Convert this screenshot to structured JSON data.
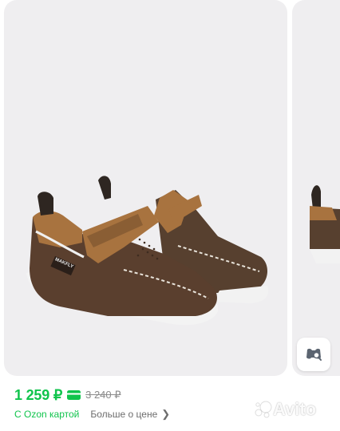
{
  "product": {
    "image_alt": "Brown boat shoes with velcro strap",
    "brand_tag": "MAKFLY",
    "price": "1 259 ₽",
    "old_price": "3 240 ₽",
    "ozon_label": "С Ozon картой",
    "more_label": "Больше о цене",
    "accent_color": "#10c44c"
  },
  "icons": {
    "lens": "visual-search-icon",
    "card": "card-icon",
    "chevron": "chevron-right-icon"
  },
  "watermark": {
    "text": "Avito"
  }
}
